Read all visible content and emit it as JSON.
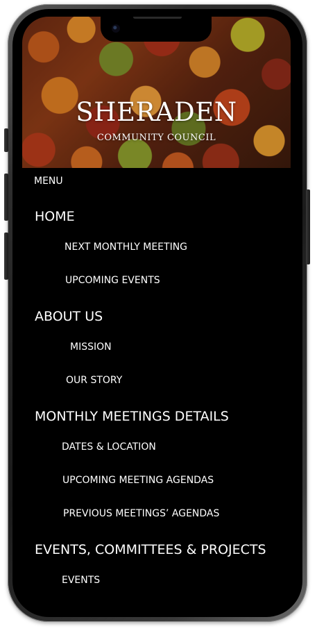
{
  "site": {
    "title": "SHERADEN",
    "subtitle": "COMMUNITY COUNCIL"
  },
  "menu": {
    "label": "MENU",
    "items": [
      {
        "label": "HOME",
        "level": "section"
      },
      {
        "label": "NEXT MONTHLY MEETING",
        "level": "sub"
      },
      {
        "label": "UPCOMING EVENTS",
        "level": "sub"
      },
      {
        "label": "ABOUT US",
        "level": "section"
      },
      {
        "label": "MISSION",
        "level": "sub"
      },
      {
        "label": "OUR STORY",
        "level": "sub"
      },
      {
        "label": "MONTHLY MEETINGS DETAILS",
        "level": "section"
      },
      {
        "label": "DATES & LOCATION",
        "level": "sub"
      },
      {
        "label": "UPCOMING MEETING AGENDAS",
        "level": "sub"
      },
      {
        "label": "PREVIOUS MEETINGS’ AGENDAS",
        "level": "sub"
      },
      {
        "label": "EVENTS, COMMITTEES & PROJECTS",
        "level": "section"
      },
      {
        "label": "EVENTS",
        "level": "sub"
      }
    ]
  },
  "colors": {
    "background": "#000000",
    "text": "#ffffff"
  }
}
